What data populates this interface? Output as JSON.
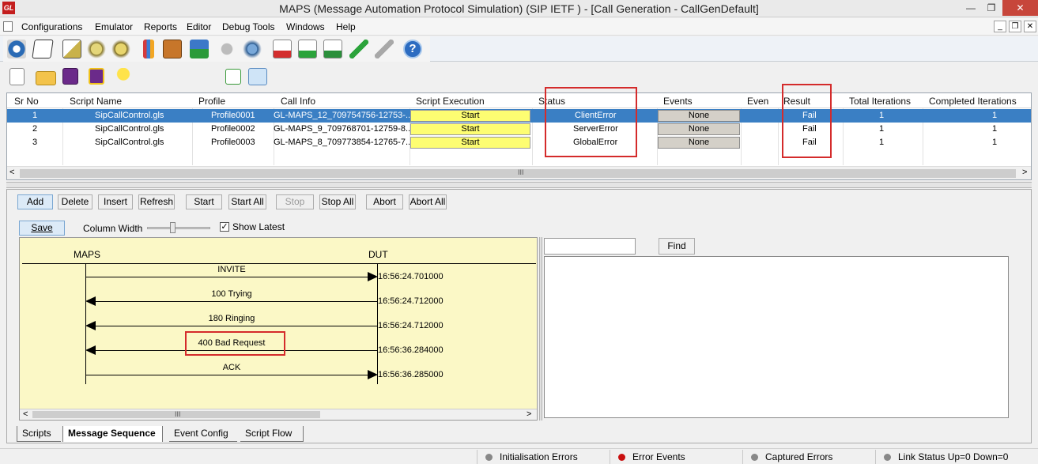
{
  "window": {
    "title": "MAPS (Message Automation Protocol Simulation)  (SIP IETF ) - [Call Generation  - CallGenDefault]",
    "logo": "GL",
    "minimize": "—",
    "restore": "❐",
    "close": "✕"
  },
  "menu": {
    "items": [
      "Configurations",
      "Emulator",
      "Reports",
      "Editor",
      "Debug Tools",
      "Windows",
      "Help"
    ],
    "mdi_min": "_",
    "mdi_restore": "❐",
    "mdi_close": "✕"
  },
  "grid": {
    "headers": [
      "Sr No",
      "Script Name",
      "Profile",
      "Call Info",
      "Script Execution",
      "Status",
      "Events",
      "Even",
      "Result",
      "Total Iterations",
      "Completed Iterations"
    ],
    "rows": [
      {
        "srno": "1",
        "script": "SipCallControl.gls",
        "profile": "Profile0001",
        "callinfo": "GL-MAPS_12_709754756-12753-...",
        "exec": "Start",
        "status": "ClientError",
        "events": "None",
        "result": "Fail",
        "total": "1",
        "completed": "1"
      },
      {
        "srno": "2",
        "script": "SipCallControl.gls",
        "profile": "Profile0002",
        "callinfo": "GL-MAPS_9_709768701-12759-8...",
        "exec": "Start",
        "status": "ServerError",
        "events": "None",
        "result": "Fail",
        "total": "1",
        "completed": "1"
      },
      {
        "srno": "3",
        "script": "SipCallControl.gls",
        "profile": "Profile0003",
        "callinfo": "GL-MAPS_8_709773854-12765-7...",
        "exec": "Start",
        "status": "GlobalError",
        "events": "None",
        "result": "Fail",
        "total": "1",
        "completed": "1"
      }
    ],
    "scroll_left": "<",
    "scroll_right": ">",
    "scroll_grip": "III"
  },
  "buttons": {
    "add": "Add",
    "delete": "Delete",
    "insert": "Insert",
    "refresh": "Refresh",
    "start": "Start",
    "start_all": "Start All",
    "stop": "Stop",
    "stop_all": "Stop All",
    "abort": "Abort",
    "abort_all": "Abort All"
  },
  "sequence": {
    "save": "Save",
    "column_width": "Column Width",
    "show_latest": "Show Latest",
    "show_latest_checked": true,
    "left_entity": "MAPS",
    "right_entity": "DUT",
    "messages": [
      {
        "label": "INVITE",
        "direction": "right",
        "time": "16:56:24.701000"
      },
      {
        "label": "100  Trying",
        "direction": "left",
        "time": "16:56:24.712000"
      },
      {
        "label": "180  Ringing",
        "direction": "left",
        "time": "16:56:24.712000"
      },
      {
        "label": "400  Bad Request",
        "direction": "left",
        "time": "16:56:36.284000"
      },
      {
        "label": "ACK",
        "direction": "right",
        "time": "16:56:36.285000"
      }
    ],
    "scroll_left": "<",
    "scroll_right": ">",
    "scroll_grip": "III"
  },
  "find": {
    "value": "",
    "button": "Find"
  },
  "tabs": [
    "Scripts",
    "Message Sequence",
    "Event Config",
    "Script Flow"
  ],
  "status": {
    "items": [
      "Initialisation Errors",
      "Error Events",
      "Captured Errors",
      "Link Status Up=0 Down=0"
    ]
  },
  "colors": {
    "selected_row": "#3a7fc4",
    "start_button": "#fdfd72",
    "sequence_bg": "#fbf8c6",
    "highlight_box": "#d42b2b",
    "error_dot": "#c90f0f"
  }
}
